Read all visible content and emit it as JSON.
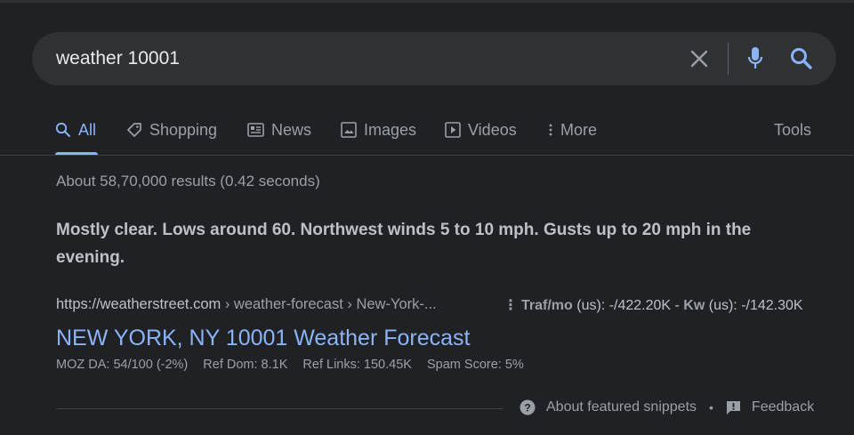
{
  "search": {
    "query": "weather 10001"
  },
  "tabs": [
    {
      "label": "All",
      "icon": "search-icon"
    },
    {
      "label": "Shopping",
      "icon": "tag-icon"
    },
    {
      "label": "News",
      "icon": "news-icon"
    },
    {
      "label": "Images",
      "icon": "image-icon"
    },
    {
      "label": "Videos",
      "icon": "play-icon"
    },
    {
      "label": "More",
      "icon": "more-vert-icon"
    }
  ],
  "tools_label": "Tools",
  "result_stats": "About 58,70,000 results (0.42 seconds)",
  "snippet_text": "Mostly clear. Lows around 60. Northwest winds 5 to 10 mph. Gusts up to 20 mph in the evening.",
  "result": {
    "url": "https://weatherstreet.com",
    "breadcrumb": " › weather-forecast › New-York-...",
    "title": "NEW YORK, NY 10001 Weather Forecast"
  },
  "seo": {
    "traffic_label": "Traf/mo",
    "traffic_region": " (us): ",
    "traffic_value": "-/422.20K",
    "separator": " - ",
    "kw_label": "Kw",
    "kw_region": " (us): ",
    "kw_value": "-/142.30K"
  },
  "moz": {
    "da": "MOZ DA: 54/100 (-2%)",
    "ref_dom": "Ref Dom: 8.1K",
    "ref_links": "Ref Links: 150.45K",
    "spam": "Spam Score: 5%"
  },
  "footer": {
    "about": "About featured snippets",
    "bullet": "•",
    "feedback": "Feedback"
  },
  "colors": {
    "background": "#202124",
    "link": "#8ab4f8",
    "searchbar": "#303134"
  }
}
